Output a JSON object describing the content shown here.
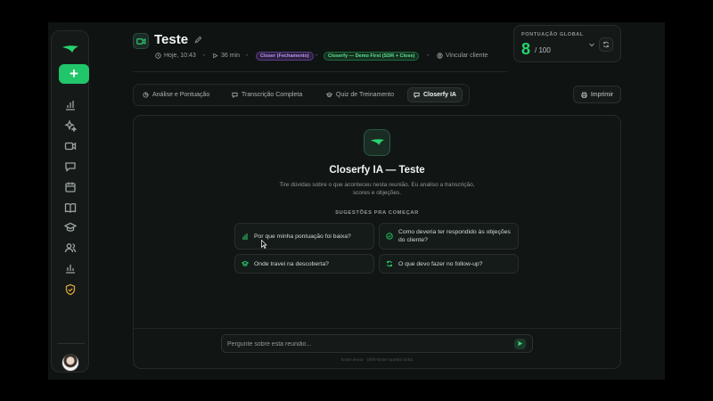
{
  "meeting": {
    "title": "Teste",
    "date_time": "Hoje, 10:43",
    "duration": "36 min",
    "tag_stage": "Closer (Fechamento)",
    "tag_script": "Closerfy — Demo First (SDR + Close)",
    "link_client": "Vincular cliente"
  },
  "score": {
    "label": "PONTUAÇÃO GLOBAL",
    "value": "8",
    "max": "/ 100"
  },
  "tabs": [
    {
      "label": "Análise e Pontuação",
      "active": false
    },
    {
      "label": "Transcrição Completa",
      "active": false
    },
    {
      "label": "Quiz de Treinamento",
      "active": false
    },
    {
      "label": "Closerfy IA",
      "active": true
    }
  ],
  "print_label": "Imprimir",
  "ai": {
    "title": "Closerfy IA — Teste",
    "subtitle": "Tire dúvidas sobre o que aconteceu nesta reunião. Eu analiso a transcrição, scores e objeções.",
    "suggestions_label": "SUGESTÕES PRA COMEÇAR",
    "suggestions": [
      {
        "text": "Por que minha pontuação foi baixa?",
        "icon": "bar-chart-icon"
      },
      {
        "text": "Como deveria ter respondido às objeções do cliente?",
        "icon": "check-circle-icon"
      },
      {
        "text": "Onde travei na descoberta?",
        "icon": "graduation-cap-icon"
      },
      {
        "text": "O que devo fazer no follow-up?",
        "icon": "refresh-icon"
      }
    ],
    "input_placeholder": "Pergunte sobre esta reunião...",
    "hint": "Enter envia · Shift+Enter quebra linha"
  },
  "colors": {
    "accent": "#21c56a",
    "score": "#27d46f",
    "purple_tag": "#b894f0",
    "warning_icon": "#d9a33a"
  }
}
